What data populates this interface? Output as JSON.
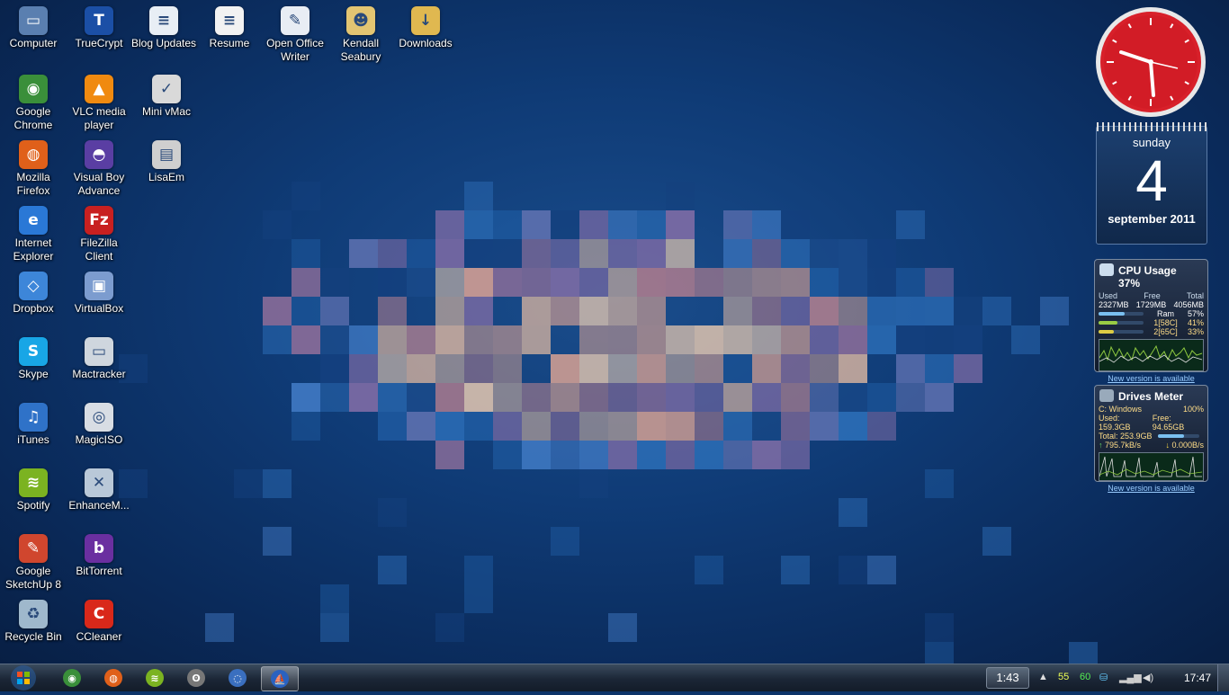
{
  "desktop_icons": [
    {
      "label": "Computer",
      "icon": "computer-icon",
      "color": "#5a7fb0",
      "glyph": "▭"
    },
    {
      "label": "TrueCrypt",
      "icon": "truecrypt-icon",
      "color": "#1b4fa6",
      "glyph": "T"
    },
    {
      "label": "Blog Updates",
      "icon": "document-icon",
      "color": "#e8eef5",
      "glyph": "≡"
    },
    {
      "label": "Resume",
      "icon": "document-icon",
      "color": "#f2f2f2",
      "glyph": "≡"
    },
    {
      "label": "Open Office Writer",
      "icon": "openoffice-writer-icon",
      "color": "#e8edf4",
      "glyph": "✎"
    },
    {
      "label": "Kendall Seabury",
      "icon": "user-folder-icon",
      "color": "#e3c572",
      "glyph": "☻"
    },
    {
      "label": "Downloads",
      "icon": "downloads-folder-icon",
      "color": "#e0b850",
      "glyph": "↓"
    },
    {
      "label": "Google Chrome",
      "icon": "chrome-icon",
      "color": "#3a8f3a",
      "glyph": "◉"
    },
    {
      "label": "VLC media player",
      "icon": "vlc-icon",
      "color": "#f08a10",
      "glyph": "▲"
    },
    {
      "label": "Mini vMac",
      "icon": "mac-icon",
      "color": "#d9d9d9",
      "glyph": "✓"
    },
    {
      "label": "Mozilla Firefox",
      "icon": "firefox-icon",
      "color": "#e0601a",
      "glyph": "◍"
    },
    {
      "label": "Visual Boy Advance",
      "icon": "gameboy-icon",
      "color": "#5a3ea3",
      "glyph": "◓"
    },
    {
      "label": "LisaEm",
      "icon": "lisa-icon",
      "color": "#cfcfcf",
      "glyph": "▤"
    },
    {
      "label": "Internet Explorer",
      "icon": "internet-explorer-icon",
      "color": "#2a78d6",
      "glyph": "e"
    },
    {
      "label": "FileZilla Client",
      "icon": "filezilla-icon",
      "color": "#c82020",
      "glyph": "Fz"
    },
    {
      "label": "Dropbox",
      "icon": "dropbox-icon",
      "color": "#3d86d9",
      "glyph": "◇"
    },
    {
      "label": "VirtualBox",
      "icon": "virtualbox-icon",
      "color": "#7c9ccf",
      "glyph": "▣"
    },
    {
      "label": "Skype",
      "icon": "skype-icon",
      "color": "#18a6e6",
      "glyph": "S"
    },
    {
      "label": "Mactracker",
      "icon": "mactracker-icon",
      "color": "#cfd6de",
      "glyph": "▭"
    },
    {
      "label": "iTunes",
      "icon": "itunes-icon",
      "color": "#2f72c8",
      "glyph": "♫"
    },
    {
      "label": "MagicISO",
      "icon": "disc-icon",
      "color": "#d8dde4",
      "glyph": "◎"
    },
    {
      "label": "Spotify",
      "icon": "spotify-icon",
      "color": "#7bb321",
      "glyph": "≋"
    },
    {
      "label": "EnhanceM...",
      "icon": "enhancemy-icon",
      "color": "#b9c8d8",
      "glyph": "✕"
    },
    {
      "label": "Google SketchUp 8",
      "icon": "sketchup-icon",
      "color": "#d0462e",
      "glyph": "✎"
    },
    {
      "label": "BitTorrent",
      "icon": "bittorrent-icon",
      "color": "#6a2fa0",
      "glyph": "b"
    },
    {
      "label": "Recycle Bin",
      "icon": "recycle-bin-icon",
      "color": "#9fb8cc",
      "glyph": "♻"
    },
    {
      "label": "CCleaner",
      "icon": "ccleaner-icon",
      "color": "#d9281a",
      "glyph": "C"
    }
  ],
  "calendar": {
    "day_name": "sunday",
    "day_number": "4",
    "month_year": "september 2011"
  },
  "cpu_meter": {
    "title": "CPU Usage",
    "percent": "37%",
    "col_used": "Used",
    "col_free": "Free",
    "col_total": "Total",
    "used": "2327MB",
    "free": "1729MB",
    "total": "4056MB",
    "ram_label": "Ram",
    "ram_pct": "57%",
    "ram_fill": 0.57,
    "core1_label": "1[58C]",
    "core1_pct": "41%",
    "core1_fill": 0.41,
    "core2_label": "2[65C]",
    "core2_pct": "33%",
    "core2_fill": 0.33,
    "link": "New version is available"
  },
  "drives_meter": {
    "title": "Drives Meter",
    "drive": "C: Windows",
    "drive_pct": "100%",
    "used": "Used: 159.3GB",
    "free": "Free: 94.65GB",
    "total": "Total: 253.9GB",
    "up": "795.7kB/s",
    "down": "0.000B/s",
    "used_fill": 0.63,
    "link": "New version is available"
  },
  "taskbar": {
    "time_box": "1:43",
    "tray_num1": "55",
    "tray_num2": "60",
    "clock": "17:47",
    "buttons": [
      {
        "name": "chrome",
        "icon": "chrome-icon",
        "color": "#3a8f3a",
        "glyph": "◉",
        "active": false
      },
      {
        "name": "firefox",
        "icon": "firefox-icon",
        "color": "#e0601a",
        "glyph": "◍",
        "active": false
      },
      {
        "name": "spotify",
        "icon": "spotify-icon",
        "color": "#7bb321",
        "glyph": "≋",
        "active": false
      },
      {
        "name": "owl-app",
        "icon": "owl-icon",
        "color": "#777777",
        "glyph": "ʘ",
        "active": false
      },
      {
        "name": "app-circle",
        "icon": "app-circle-icon",
        "color": "#3a6fbf",
        "glyph": "◌",
        "active": false
      },
      {
        "name": "sailboat-app",
        "icon": "sailboat-icon",
        "color": "#2a62c0",
        "glyph": "⛵",
        "active": true
      }
    ]
  }
}
